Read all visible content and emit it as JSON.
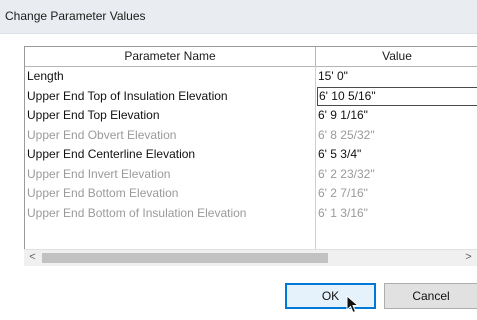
{
  "window": {
    "title": "Change Parameter Values"
  },
  "table": {
    "headers": {
      "name": "Parameter Name",
      "value": "Value"
    },
    "rows": [
      {
        "name": "Length",
        "value": "15'  0\"",
        "enabled": true,
        "focused": false
      },
      {
        "name": "Upper End Top of Insulation Elevation",
        "value": "6'  10 5/16\"",
        "enabled": true,
        "focused": true
      },
      {
        "name": "Upper End Top Elevation",
        "value": "6'  9 1/16\"",
        "enabled": true,
        "focused": false
      },
      {
        "name": "Upper End Obvert Elevation",
        "value": "6'  8 25/32\"",
        "enabled": false,
        "focused": false
      },
      {
        "name": "Upper End Centerline Elevation",
        "value": "6'  5 3/4\"",
        "enabled": true,
        "focused": false
      },
      {
        "name": "Upper End Invert Elevation",
        "value": "6'  2 23/32\"",
        "enabled": false,
        "focused": false
      },
      {
        "name": "Upper End Bottom Elevation",
        "value": "6'  2 7/16\"",
        "enabled": false,
        "focused": false
      },
      {
        "name": "Upper End Bottom of Insulation Elevation",
        "value": "6'  1 3/16\"",
        "enabled": false,
        "focused": false
      }
    ]
  },
  "scrollbar": {
    "left_arrow": "<",
    "right_arrow": ">"
  },
  "buttons": {
    "ok_label": "OK",
    "cancel_label": "Cancel"
  },
  "colors": {
    "titlebar": "#e9ecf0",
    "enabled_text": "#111111",
    "disabled_text": "#9a9a9a",
    "default_button_border": "#0078d7"
  }
}
